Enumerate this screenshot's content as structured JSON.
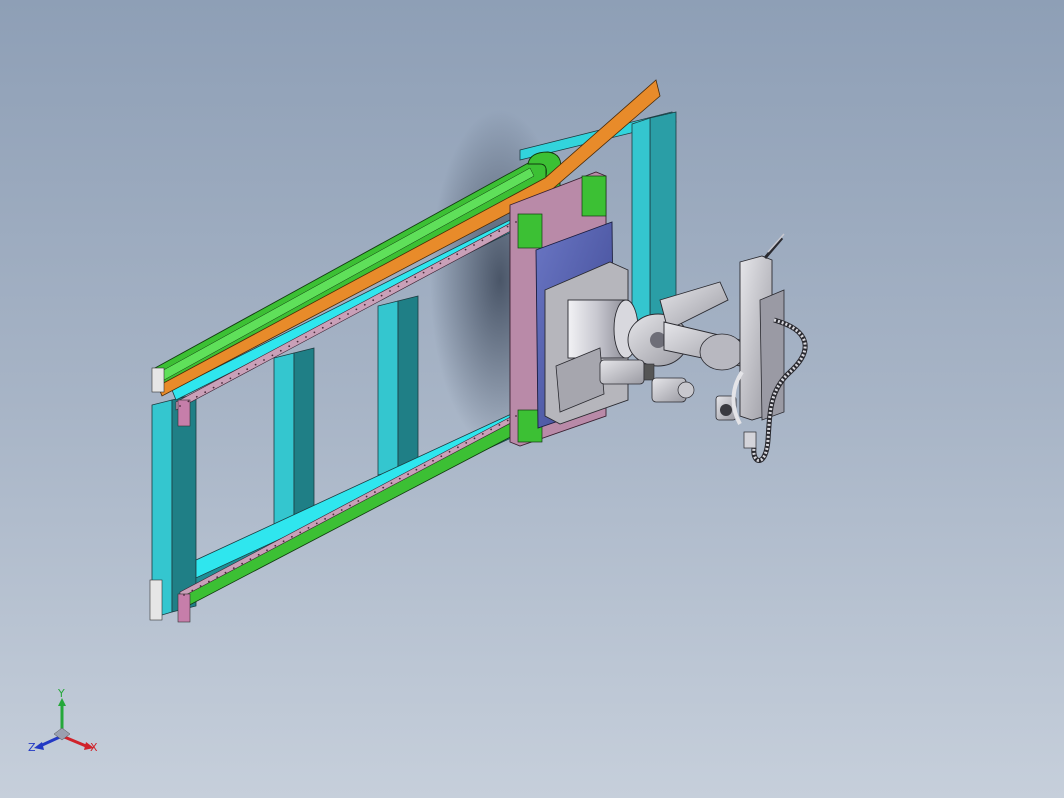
{
  "viewport": {
    "background_top": "#8e9fb6",
    "background_bottom": "#c6cfdb"
  },
  "model": {
    "frame_color": "#2fc9d0",
    "frame_dark": "#1f7f86",
    "rail_green": "#38b82e",
    "rail_orange": "#e08a2a",
    "carriage_purple": "#b27aa0",
    "plate_blue": "#4b57a8",
    "robot_color": "#c9c9ce"
  },
  "triad": {
    "x_label": "X",
    "y_label": "Y",
    "z_label": "Z",
    "x_color": "#d0222a",
    "y_color": "#25a83a",
    "z_color": "#2339c4"
  }
}
